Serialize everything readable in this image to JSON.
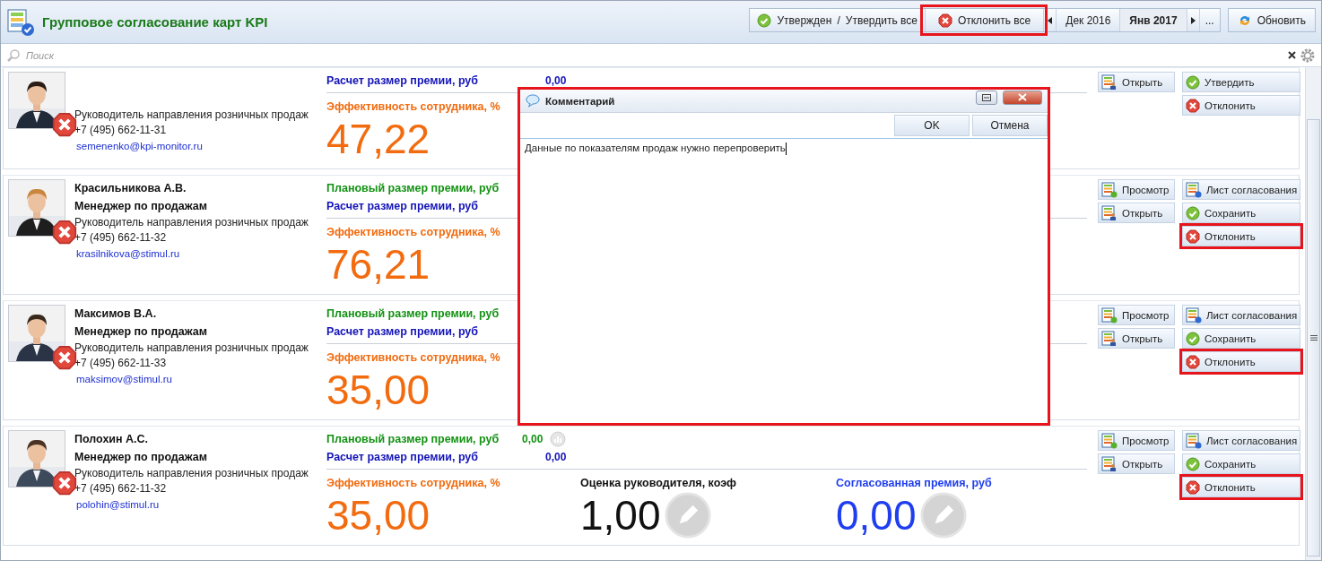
{
  "header": {
    "title": "Групповое согласование карт KPI"
  },
  "toolbar": {
    "approved_status": "Утвержден",
    "separator": "/",
    "approve_all": "Утвердить все",
    "reject_all": {
      "label": "Отклонить все",
      "highlighted": true
    },
    "periods": [
      {
        "label": "Дек 2016",
        "selected": false
      },
      {
        "label": "Янв 2017",
        "selected": true
      }
    ],
    "more": "...",
    "refresh": "Обновить"
  },
  "search": {
    "placeholder": "Поиск"
  },
  "cards": [
    {
      "position": "Руководитель направления розничных продаж",
      "phone": "+7 (495) 662-11-31",
      "email": "semenenko@kpi-monitor.ru",
      "calc": {
        "label": "Расчет размер премии, руб",
        "value": "0,00"
      },
      "efficiency": {
        "label": "Эффективность сотрудника, %",
        "value": "47,22"
      },
      "left_buttons": [
        {
          "kind": "open",
          "label": "Открыть"
        }
      ],
      "right_buttons": [
        {
          "kind": "approve",
          "label": "Утвердить",
          "highlighted": false
        },
        {
          "kind": "reject",
          "label": "Отклонить",
          "highlighted": false
        }
      ]
    },
    {
      "name": "Красильникова А.В.",
      "title": "Менеджер по продажам",
      "position": "Руководитель направления розничных продаж",
      "phone": "+7 (495) 662-11-32",
      "email": "krasilnikova@stimul.ru",
      "planned": {
        "label": "Плановый размер премии, руб"
      },
      "calc": {
        "label": "Расчет размер премии, руб"
      },
      "efficiency": {
        "label": "Эффективность сотрудника, %",
        "value": "76,21"
      },
      "left_buttons": [
        {
          "kind": "view",
          "label": "Просмотр"
        },
        {
          "kind": "open",
          "label": "Открыть"
        }
      ],
      "right_buttons": [
        {
          "kind": "sheet",
          "label": "Лист согласования",
          "highlighted": false
        },
        {
          "kind": "approve",
          "label": "Сохранить",
          "highlighted": false
        },
        {
          "kind": "reject",
          "label": "Отклонить",
          "highlighted": true
        }
      ]
    },
    {
      "name": "Максимов В.А.",
      "title": "Менеджер по продажам",
      "position": "Руководитель направления розничных продаж",
      "phone": "+7 (495) 662-11-33",
      "email": "maksimov@stimul.ru",
      "planned": {
        "label": "Плановый размер премии, руб"
      },
      "calc": {
        "label": "Расчет размер премии, руб"
      },
      "efficiency": {
        "label": "Эффективность сотрудника, %",
        "value": "35,00"
      },
      "left_buttons": [
        {
          "kind": "view",
          "label": "Просмотр"
        },
        {
          "kind": "open",
          "label": "Открыть"
        }
      ],
      "right_buttons": [
        {
          "kind": "sheet",
          "label": "Лист согласования",
          "highlighted": false
        },
        {
          "kind": "approve",
          "label": "Сохранить",
          "highlighted": false
        },
        {
          "kind": "reject",
          "label": "Отклонить",
          "highlighted": true
        }
      ]
    },
    {
      "name": "Полохин А.С.",
      "title": "Менеджер по продажам",
      "position": "Руководитель направления розничных продаж",
      "phone": "+7 (495) 662-11-32",
      "email": "polohin@stimul.ru",
      "planned": {
        "label": "Плановый размер премии, руб",
        "value": "0,00"
      },
      "calc": {
        "label": "Расчет размер премии, руб",
        "value": "0,00"
      },
      "efficiency": {
        "label": "Эффективность сотрудника, %",
        "value": "35,00"
      },
      "rating": {
        "label": "Оценка руководителя, коэф",
        "value": "1,00"
      },
      "agreed": {
        "label": "Согласованная премия, руб",
        "value": "0,00"
      },
      "left_buttons": [
        {
          "kind": "view",
          "label": "Просмотр"
        },
        {
          "kind": "open",
          "label": "Открыть"
        }
      ],
      "right_buttons": [
        {
          "kind": "sheet",
          "label": "Лист согласования",
          "highlighted": false
        },
        {
          "kind": "approve",
          "label": "Сохранить",
          "highlighted": false
        },
        {
          "kind": "reject",
          "label": "Отклонить",
          "highlighted": true
        }
      ]
    }
  ],
  "dialog": {
    "title": "Комментарий",
    "highlighted": true,
    "buttons": [
      "OK",
      "Отмена"
    ],
    "value": "Данные по показателям продаж нужно перепроверить"
  }
}
